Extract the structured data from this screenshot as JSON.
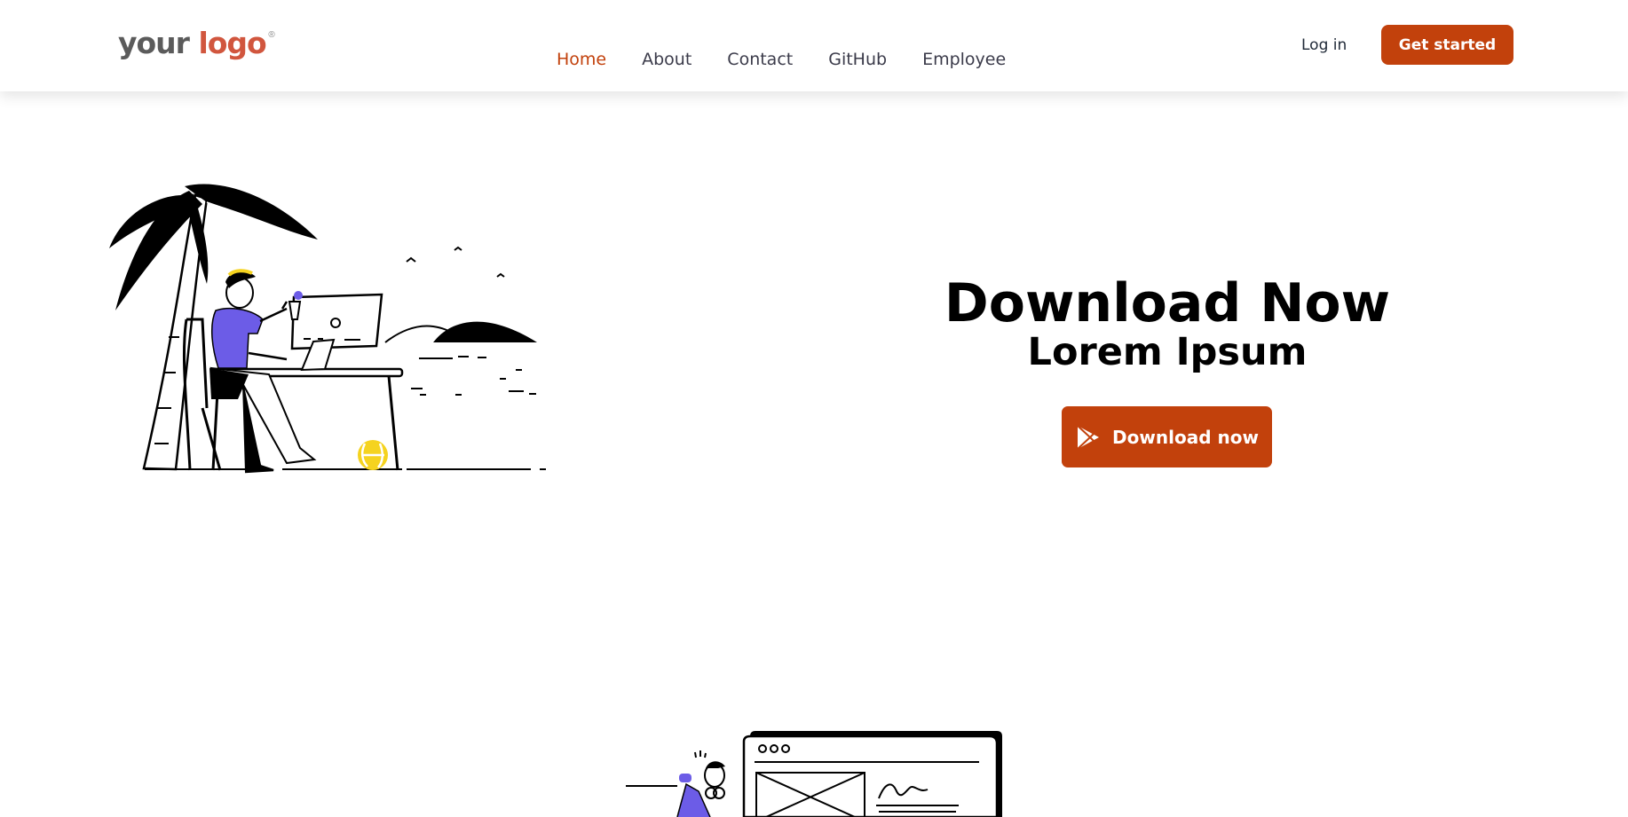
{
  "header": {
    "logo": {
      "text_your": "your",
      "text_logo": "logo",
      "mark": "®"
    },
    "nav": [
      {
        "label": "Home",
        "active": true
      },
      {
        "label": "About",
        "active": false
      },
      {
        "label": "Contact",
        "active": false
      },
      {
        "label": "GitHub",
        "active": false
      },
      {
        "label": "Employee",
        "active": false
      }
    ],
    "login_label": "Log in",
    "cta_label": "Get started"
  },
  "hero": {
    "title": "Download Now",
    "subtitle": "Lorem Ipsum",
    "download_label": "Download now",
    "download_icon": "play-store-icon",
    "illustration": "remote-worker-beach-illustration"
  },
  "second_section": {
    "illustration": "wireframe-browser-illustration"
  },
  "colors": {
    "accent": "#c2410c",
    "nav_text": "#3b3b4a",
    "logo_grey": "#5b5b5b",
    "logo_red": "#d1563e",
    "illustration_purple": "#6c5ce7",
    "illustration_yellow": "#f5d31f"
  }
}
